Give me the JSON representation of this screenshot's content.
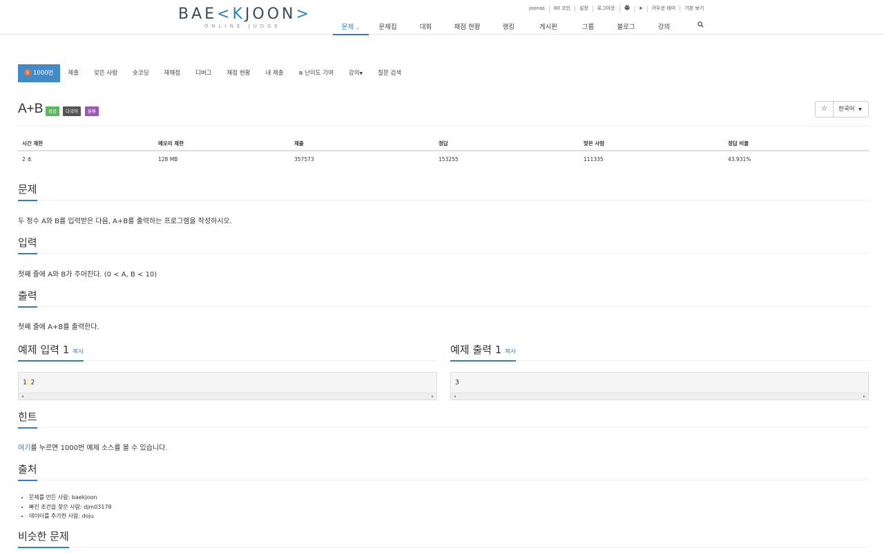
{
  "header": {
    "logo_left": "BAE",
    "logo_accent": "K",
    "logo_right": "JOON",
    "logo_sub": "ONLINE JUDGE",
    "topbar": [
      "joonas",
      "80 코인",
      "설정",
      "로그아웃",
      "globe-icon",
      "star-icon",
      "어두운 테마",
      "기본 보기"
    ],
    "nav": [
      {
        "label": "문제",
        "active": true,
        "dropdown": true
      },
      {
        "label": "문제집"
      },
      {
        "label": "대회"
      },
      {
        "label": "채점 현황"
      },
      {
        "label": "랭킹"
      },
      {
        "label": "게시판"
      },
      {
        "label": "그룹"
      },
      {
        "label": "블로그"
      },
      {
        "label": "강의"
      },
      {
        "label": "search-icon"
      }
    ]
  },
  "subtabs": {
    "tier_badge": "5",
    "problem_no": "1000번",
    "submit": "제출",
    "solved_users": "맞은 사람",
    "shortest": "숏코딩",
    "rejudge": "재채점",
    "debug": "디버그",
    "status": "채점 현황",
    "my_submissions": "내 제출",
    "difficulty": "난이도 기여",
    "lecture": "강의",
    "questions": "질문 검색"
  },
  "problem": {
    "title": "A+B",
    "labels": [
      {
        "text": "성공",
        "color": "#5cb85c"
      },
      {
        "text": "다국어",
        "color": "#555555"
      },
      {
        "text": "분류",
        "color": "#9b59b6"
      }
    ],
    "language": "한국어"
  },
  "info_table": {
    "headers": [
      "시간 제한",
      "메모리 제한",
      "제출",
      "정답",
      "맞은 사람",
      "정답 비율"
    ],
    "values": [
      "2 초",
      "128 MB",
      "357573",
      "153255",
      "111335",
      "43.931%"
    ]
  },
  "sections": {
    "problem_h": "문제",
    "problem_text": "두 정수 A와 B를 입력받은 다음, A+B를 출력하는 프로그램을 작성하시오.",
    "input_h": "입력",
    "input_text": "첫째 줄에 A와 B가 주어진다. (0 < A, B < 10)",
    "output_h": "출력",
    "output_text": "첫째 줄에 A+B를 출력한다.",
    "sample_in_h": "예제 입력 1",
    "sample_out_h": "예제 출력 1",
    "copy": "복사",
    "sample_in_a": "1",
    "sample_in_b": "2",
    "sample_out": "3",
    "hint_h": "힌트",
    "hint_link": "여기",
    "hint_rest": "를 누르면 1000번 예제 소스를 볼 수 있습니다.",
    "source_h": "출처",
    "source_items": [
      "문제를 만든 사람: baekjoon",
      "빠진 조건을 찾은 사람: djm03178",
      "데이터를 추가한 사람: doju"
    ],
    "similar_h": "비슷한 문제"
  },
  "colors": {
    "accent": "#2f7fc1",
    "active_tab": "#428bca",
    "tier_badge": "#e0743a"
  }
}
